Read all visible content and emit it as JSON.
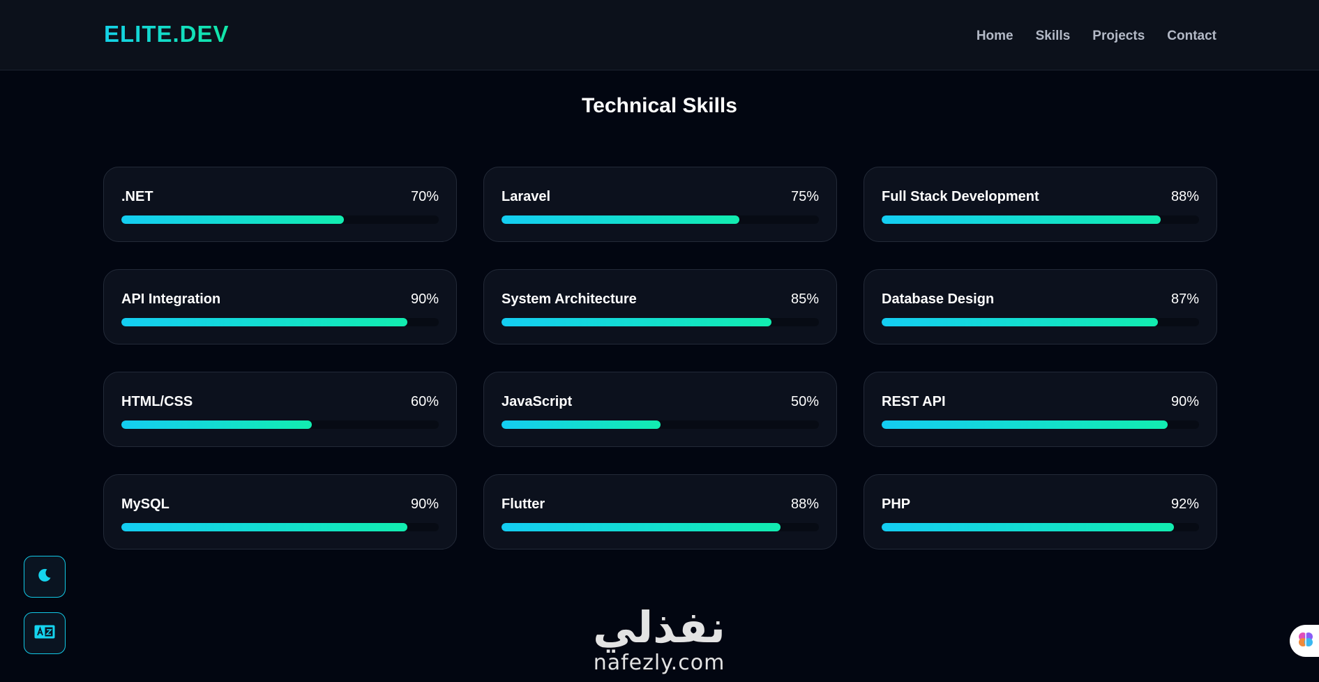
{
  "header": {
    "logo": "ELITE.DEV",
    "nav": [
      "Home",
      "Skills",
      "Projects",
      "Contact"
    ]
  },
  "section": {
    "title": "Technical Skills"
  },
  "skills": [
    {
      "name": ".NET",
      "percent_label": "70%",
      "percent": 70
    },
    {
      "name": "Laravel",
      "percent_label": "75%",
      "percent": 75
    },
    {
      "name": "Full Stack Development",
      "percent_label": "88%",
      "percent": 88
    },
    {
      "name": "API Integration",
      "percent_label": "90%",
      "percent": 90
    },
    {
      "name": "System Architecture",
      "percent_label": "85%",
      "percent": 85
    },
    {
      "name": "Database Design",
      "percent_label": "87%",
      "percent": 87
    },
    {
      "name": "HTML/CSS",
      "percent_label": "60%",
      "percent": 60
    },
    {
      "name": "JavaScript",
      "percent_label": "50%",
      "percent": 50
    },
    {
      "name": "REST API",
      "percent_label": "90%",
      "percent": 90
    },
    {
      "name": "MySQL",
      "percent_label": "90%",
      "percent": 90
    },
    {
      "name": "Flutter",
      "percent_label": "88%",
      "percent": 88
    },
    {
      "name": "PHP",
      "percent_label": "92%",
      "percent": 92
    }
  ],
  "controls": {
    "theme_icon": "moon-icon",
    "language_icon": "translate-icon",
    "assistant_icon": "brain-icon"
  },
  "watermark": {
    "arabic": "نفذلي",
    "latin": "nafezly.com"
  },
  "colors": {
    "accent_start": "#14cdf2",
    "accent_end": "#12edb0",
    "background": "#020611",
    "card": "#0c111d"
  }
}
